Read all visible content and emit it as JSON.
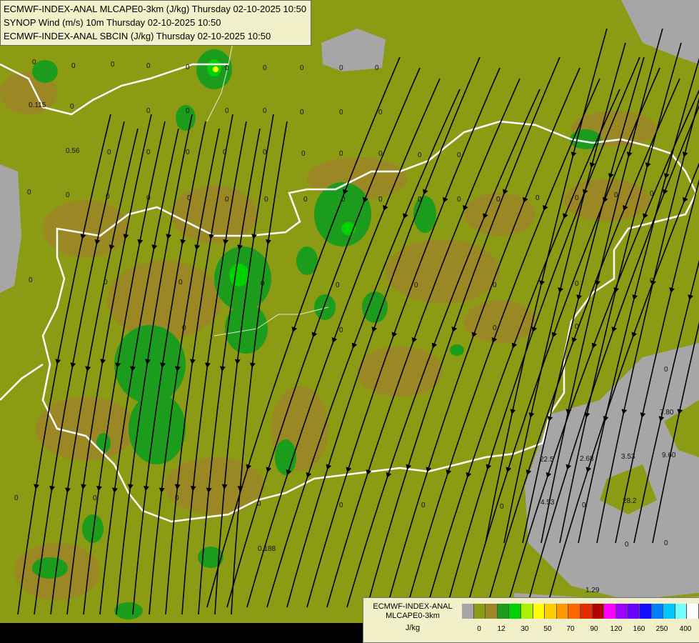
{
  "header": {
    "line1": "ECMWF-INDEX-ANAL MLCAPE0-3km (J/kg) Thursday 02-10-2025 10:50",
    "line2": "SYNOP Wind (m/s) 10m Thursday 02-10-2025 10:50",
    "line3": "ECMWF-INDEX-ANAL SBCIN (J/kg) Thursday 02-10-2025 10:50"
  },
  "legend": {
    "model": "ECMWF-INDEX-ANAL",
    "parameter": "MLCAPE0-3km",
    "unit": "J/kg",
    "colors": [
      "#a6a6a6",
      "#8c9b14",
      "#9c8626",
      "#1c9c1c",
      "#00d200",
      "#aaf000",
      "#ffff00",
      "#ffcc00",
      "#ff9900",
      "#ff6600",
      "#e62b00",
      "#b40000",
      "#ff00ff",
      "#a000ff",
      "#6a00ff",
      "#1010ff",
      "#0080ff",
      "#00c8ff",
      "#70ffff",
      "#ffffff"
    ],
    "tick_labels": [
      "0",
      "12",
      "30",
      "50",
      "70",
      "90",
      "120",
      "160",
      "250",
      "400"
    ]
  },
  "map_values": [
    "0",
    "0",
    "0",
    "0",
    "0",
    "0",
    "0",
    "0",
    "0",
    "0",
    "0.115",
    "0",
    "0",
    "0",
    "0",
    "0",
    "0",
    "0",
    "0",
    "0.56",
    "0",
    "0",
    "0",
    "0",
    "0",
    "0",
    "0",
    "0",
    "0",
    "0",
    "0",
    "0",
    "0",
    "0",
    "0",
    "0",
    "0",
    "0",
    "0",
    "0",
    "0",
    "0",
    "0",
    "0",
    "0",
    "0",
    "0",
    "0",
    "0",
    "0",
    "0",
    "0",
    "0",
    "0",
    "0",
    "0",
    "0",
    "0",
    "0",
    "0",
    "7.80",
    "9.60",
    "22.5",
    "2.68",
    "3.53",
    "4.53",
    "28.2",
    "0.188",
    "1.29",
    "0",
    "0",
    "0",
    "0",
    "0",
    "0",
    "0",
    "0",
    "0",
    "0",
    "0"
  ],
  "colors": {
    "background": "#8c9b14",
    "brown": "#9c8626",
    "green": "#1c9c1c",
    "bright_green": "#00d200",
    "gray": "#a6a6a6",
    "border": "#ffffff"
  }
}
